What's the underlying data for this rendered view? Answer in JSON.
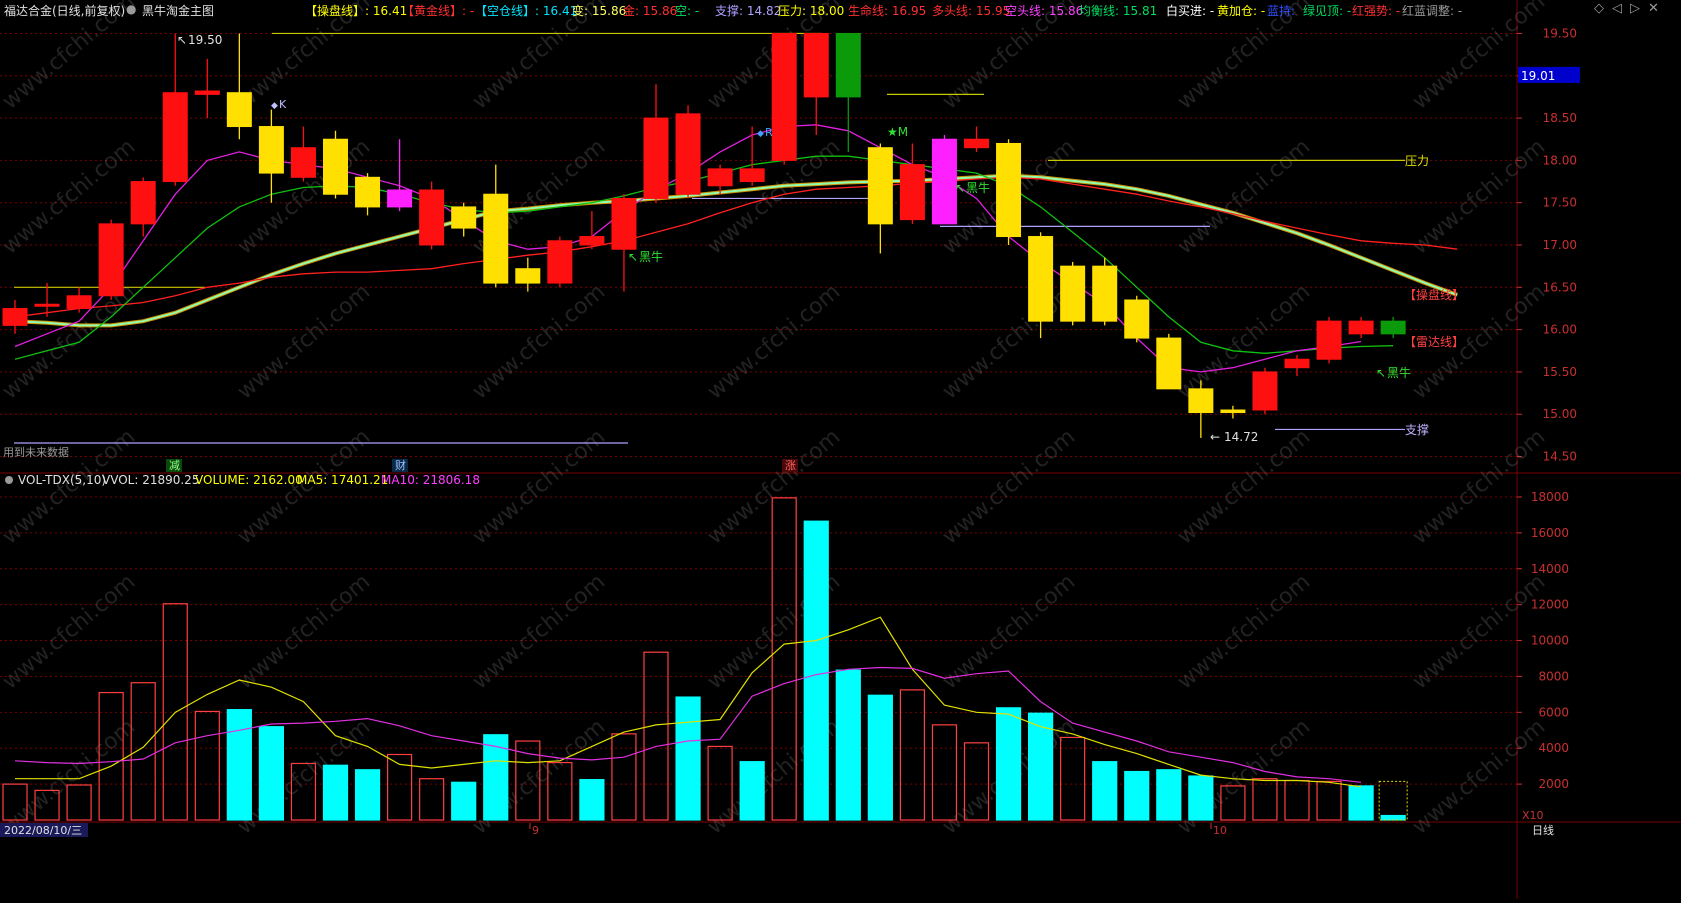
{
  "header": {
    "title": "福达合金(日线,前复权)",
    "indicator_name": "黑牛淘金主图",
    "items": [
      {
        "text": "【操盘线】: 16.41",
        "color": "#ffff00"
      },
      {
        "text": "【黄金线】: -",
        "color": "#ff3030"
      },
      {
        "text": "【空仓线】: 16.41",
        "color": "#00e5ff"
      },
      {
        "text": "变: 15.86",
        "color": "#ffff66"
      },
      {
        "text": "金: 15.86",
        "color": "#ff3030"
      },
      {
        "text": "空: -",
        "color": "#00e060"
      },
      {
        "text": "支撑: 14.82",
        "color": "#b0a0ff"
      },
      {
        "text": "压力: 18.00",
        "color": "#ffff00"
      },
      {
        "text": "生命线: 16.95",
        "color": "#ff3030"
      },
      {
        "text": "多头线: 15.95",
        "color": "#ff3030"
      },
      {
        "text": "空头线: 15.86",
        "color": "#ff40ff"
      },
      {
        "text": "均衡线: 15.81",
        "color": "#00e060"
      },
      {
        "text": "白买进: -",
        "color": "#ffffff"
      },
      {
        "text": "黄加仓: -",
        "color": "#ffff00"
      },
      {
        "text": "蓝持:",
        "color": "#3050ff"
      },
      {
        "text": "绿见顶: -",
        "color": "#00e060"
      },
      {
        "text": "红强势: -",
        "color": "#ff3030"
      },
      {
        "text": "红蓝调整: -",
        "color": "#9a9a9a"
      }
    ]
  },
  "price_axis": {
    "ticks": [
      "19.50",
      "19.00",
      "18.50",
      "18.00",
      "17.50",
      "17.00",
      "16.50",
      "16.00",
      "15.50",
      "15.00",
      "14.50"
    ],
    "current_price": "19.01"
  },
  "volume_header": {
    "name": "VOL-TDX(5,10)",
    "vvol": "VVOL: 21890.25",
    "volume": "VOLUME: 2162.00",
    "ma5": "MA5: 17401.21",
    "ma10": "MA10: 21806.18"
  },
  "volume_axis": {
    "ticks": [
      "18000",
      "16000",
      "14000",
      "12000",
      "10000",
      "8000",
      "6000",
      "4000",
      "2000"
    ],
    "unit": "X10"
  },
  "labels": {
    "future_data": "用到未来数据",
    "event_1": "减",
    "event_2": "财",
    "event_3": "涨",
    "high_mark": "19.50",
    "low_mark": "14.72",
    "mark_k": "K",
    "mark_r": "R",
    "mark_m": "★M",
    "black_bull": "黑牛",
    "pressure": "压力",
    "support": "支撑",
    "operate_line": "【操盘线】",
    "radar_line": "【雷达线】"
  },
  "time_axis": {
    "start_date": "2022/08/10/三",
    "month_9": "9",
    "month_10": "10",
    "period": "日线"
  },
  "watermark": "www.cfchi.com",
  "colors": {
    "background": "#000000",
    "grid": "#7a0000",
    "axis_text": "#c83030",
    "up": "#ff1010",
    "yellow": "#ffe000",
    "cyan": "#00ffff",
    "green": "#0a9a0a",
    "magenta": "#ff20ff"
  },
  "chart_data": [
    {
      "type": "candlestick",
      "title": "福达合金(日线,前复权)",
      "ylim": [
        14.4,
        19.6
      ],
      "candles": [
        {
          "o": 16.05,
          "c": 16.25,
          "h": 16.35,
          "l": 15.95,
          "color": "red"
        },
        {
          "o": 16.28,
          "c": 16.3,
          "h": 16.55,
          "l": 16.15,
          "color": "red"
        },
        {
          "o": 16.25,
          "c": 16.4,
          "h": 16.5,
          "l": 16.2,
          "color": "red"
        },
        {
          "o": 16.4,
          "c": 17.25,
          "h": 17.3,
          "l": 16.35,
          "color": "red"
        },
        {
          "o": 17.25,
          "c": 17.75,
          "h": 17.8,
          "l": 17.1,
          "color": "red"
        },
        {
          "o": 17.75,
          "c": 18.8,
          "h": 19.5,
          "l": 17.7,
          "color": "red"
        },
        {
          "o": 18.78,
          "c": 18.82,
          "h": 19.2,
          "l": 18.5,
          "color": "red"
        },
        {
          "o": 18.8,
          "c": 18.4,
          "h": 19.5,
          "l": 18.25,
          "color": "yellow"
        },
        {
          "o": 18.4,
          "c": 17.85,
          "h": 18.6,
          "l": 17.5,
          "color": "yellow"
        },
        {
          "o": 17.8,
          "c": 18.15,
          "h": 18.4,
          "l": 17.75,
          "color": "red"
        },
        {
          "o": 18.25,
          "c": 17.6,
          "h": 18.35,
          "l": 17.55,
          "color": "yellow"
        },
        {
          "o": 17.8,
          "c": 17.45,
          "h": 17.85,
          "l": 17.35,
          "color": "yellow"
        },
        {
          "o": 17.45,
          "c": 17.65,
          "h": 18.25,
          "l": 17.4,
          "color": "magenta"
        },
        {
          "o": 17.65,
          "c": 17.0,
          "h": 17.75,
          "l": 16.95,
          "color": "red"
        },
        {
          "o": 17.45,
          "c": 17.2,
          "h": 17.5,
          "l": 17.1,
          "color": "yellow"
        },
        {
          "o": 17.6,
          "c": 16.55,
          "h": 17.95,
          "l": 16.5,
          "color": "yellow"
        },
        {
          "o": 16.55,
          "c": 16.72,
          "h": 16.85,
          "l": 16.45,
          "color": "yellow"
        },
        {
          "o": 16.55,
          "c": 17.05,
          "h": 17.1,
          "l": 16.5,
          "color": "red"
        },
        {
          "o": 17.0,
          "c": 17.1,
          "h": 17.4,
          "l": 16.95,
          "color": "red"
        },
        {
          "o": 16.95,
          "c": 17.55,
          "h": 17.6,
          "l": 16.45,
          "color": "red"
        },
        {
          "o": 17.55,
          "c": 18.5,
          "h": 18.9,
          "l": 17.5,
          "color": "red"
        },
        {
          "o": 17.6,
          "c": 18.55,
          "h": 18.65,
          "l": 17.55,
          "color": "red"
        },
        {
          "o": 17.7,
          "c": 17.9,
          "h": 17.95,
          "l": 17.6,
          "color": "red"
        },
        {
          "o": 17.75,
          "c": 17.9,
          "h": 18.4,
          "l": 17.7,
          "color": "red"
        },
        {
          "o": 18.0,
          "c": 19.5,
          "h": 19.5,
          "l": 17.95,
          "color": "red"
        },
        {
          "o": 18.75,
          "c": 19.5,
          "h": 19.5,
          "l": 18.3,
          "color": "red"
        },
        {
          "o": 18.75,
          "c": 19.5,
          "h": 19.5,
          "l": 18.1,
          "color": "green"
        },
        {
          "o": 18.15,
          "c": 17.25,
          "h": 18.2,
          "l": 16.9,
          "color": "yellow"
        },
        {
          "o": 17.3,
          "c": 17.95,
          "h": 18.2,
          "l": 17.25,
          "color": "red"
        },
        {
          "o": 18.25,
          "c": 17.25,
          "h": 18.3,
          "l": 17.25,
          "color": "magenta"
        },
        {
          "o": 18.15,
          "c": 18.25,
          "h": 18.4,
          "l": 18.1,
          "color": "red"
        },
        {
          "o": 18.2,
          "c": 17.1,
          "h": 18.25,
          "l": 17.0,
          "color": "yellow"
        },
        {
          "o": 17.1,
          "c": 16.1,
          "h": 17.15,
          "l": 15.9,
          "color": "yellow"
        },
        {
          "o": 16.75,
          "c": 16.1,
          "h": 16.8,
          "l": 16.05,
          "color": "yellow"
        },
        {
          "o": 16.75,
          "c": 16.1,
          "h": 16.85,
          "l": 16.05,
          "color": "yellow"
        },
        {
          "o": 16.35,
          "c": 15.9,
          "h": 16.4,
          "l": 15.85,
          "color": "yellow"
        },
        {
          "o": 15.9,
          "c": 15.3,
          "h": 15.95,
          "l": 15.3,
          "color": "yellow"
        },
        {
          "o": 15.3,
          "c": 15.02,
          "h": 15.4,
          "l": 14.72,
          "color": "yellow"
        },
        {
          "o": 15.05,
          "c": 15.02,
          "h": 15.1,
          "l": 14.95,
          "color": "yellow"
        },
        {
          "o": 15.05,
          "c": 15.5,
          "h": 15.55,
          "l": 15.0,
          "color": "red"
        },
        {
          "o": 15.55,
          "c": 15.65,
          "h": 15.7,
          "l": 15.45,
          "color": "red"
        },
        {
          "o": 15.65,
          "c": 16.1,
          "h": 16.15,
          "l": 15.6,
          "color": "red"
        },
        {
          "o": 15.95,
          "c": 16.1,
          "h": 16.15,
          "l": 15.9,
          "color": "red"
        },
        {
          "o": 16.1,
          "c": 15.95,
          "h": 16.15,
          "l": 15.9,
          "color": "green"
        }
      ],
      "lines": [
        {
          "name": "操盘线",
          "values": [
            16.1,
            16.08,
            16.05,
            16.05,
            16.1,
            16.2,
            16.35,
            16.5,
            16.65,
            16.78,
            16.9,
            17.0,
            17.1,
            17.2,
            17.3,
            17.4,
            17.43,
            17.47,
            17.5,
            17.52,
            17.55,
            17.58,
            17.62,
            17.66,
            17.7,
            17.72,
            17.74,
            17.75,
            17.76,
            17.78,
            17.8,
            17.82,
            17.8,
            17.76,
            17.72,
            17.66,
            17.58,
            17.48,
            17.38,
            17.26,
            17.14,
            17.0,
            16.85,
            16.7,
            16.55,
            16.41
          ]
        },
        {
          "name": "生命线",
          "values": [
            16.15,
            16.2,
            16.25,
            16.28,
            16.32,
            16.4,
            16.5,
            16.55,
            16.62,
            16.66,
            16.68,
            16.68,
            16.7,
            16.72,
            16.78,
            16.83,
            16.88,
            16.92,
            16.98,
            17.05,
            17.15,
            17.25,
            17.38,
            17.5,
            17.6,
            17.66,
            17.68,
            17.7,
            17.73,
            17.75,
            17.78,
            17.8,
            17.78,
            17.72,
            17.66,
            17.6,
            17.52,
            17.45,
            17.37,
            17.28,
            17.2,
            17.12,
            17.05,
            17.02,
            17.0,
            16.95
          ]
        },
        {
          "name": "均衡线",
          "values": [
            15.65,
            15.75,
            15.85,
            16.15,
            16.5,
            16.85,
            17.2,
            17.45,
            17.6,
            17.68,
            17.7,
            17.68,
            17.6,
            17.5,
            17.42,
            17.38,
            17.4,
            17.45,
            17.5,
            17.58,
            17.68,
            17.75,
            17.85,
            17.95,
            18.0,
            18.05,
            18.05,
            18.0,
            17.95,
            17.9,
            17.85,
            17.7,
            17.45,
            17.15,
            16.85,
            16.5,
            16.15,
            15.85,
            15.75,
            15.72,
            15.75,
            15.78,
            15.8,
            15.81
          ]
        },
        {
          "name": "空头线",
          "values": [
            15.8,
            15.95,
            16.1,
            16.5,
            17.05,
            17.6,
            18.0,
            18.1,
            18.0,
            17.95,
            17.9,
            17.8,
            17.7,
            17.55,
            17.3,
            17.05,
            16.95,
            16.98,
            17.1,
            17.4,
            17.65,
            17.85,
            18.1,
            18.3,
            18.4,
            18.42,
            18.35,
            18.15,
            17.95,
            17.8,
            17.55,
            17.1,
            16.8,
            16.55,
            16.3,
            15.9,
            15.55,
            15.5,
            15.55,
            15.65,
            15.75,
            15.8,
            15.86
          ]
        }
      ]
    },
    {
      "type": "bar",
      "title": "VOL-TDX(5,10)",
      "ylim": [
        0,
        18500
      ],
      "volumes": [
        2000,
        1650,
        1950,
        7100,
        7650,
        12050,
        6050,
        6150,
        5200,
        3150,
        3050,
        2800,
        3650,
        2300,
        2100,
        4750,
        4400,
        3200,
        2250,
        4800,
        9350,
        6850,
        4100,
        3250,
        17950,
        16650,
        8350,
        6950,
        7250,
        5300,
        4300,
        6250,
        5950,
        4600,
        3250,
        2700,
        2800,
        2450,
        1900,
        2300,
        2200,
        2150,
        1900,
        250
      ],
      "volume_colors": [
        "r",
        "r",
        "r",
        "r",
        "r",
        "r",
        "r",
        "c",
        "c",
        "r",
        "c",
        "c",
        "r",
        "r",
        "c",
        "c",
        "r",
        "r",
        "c",
        "r",
        "r",
        "c",
        "r",
        "c",
        "r",
        "c",
        "c",
        "c",
        "r",
        "r",
        "r",
        "c",
        "c",
        "r",
        "c",
        "c",
        "c",
        "c",
        "r",
        "r",
        "r",
        "r",
        "c",
        "c"
      ],
      "ma5": [
        2300,
        2300,
        2300,
        3000,
        4050,
        6000,
        7000,
        7800,
        7400,
        6600,
        4700,
        4100,
        3100,
        2900,
        3100,
        3300,
        3200,
        3300,
        4100,
        4900,
        5300,
        5450,
        5600,
        8200,
        9800,
        10000,
        10600,
        11300,
        8400,
        6400,
        6000,
        5900,
        5200,
        4800,
        4200,
        3700,
        3100,
        2500,
        2300,
        2200,
        2200,
        2100,
        1850
      ],
      "ma10": [
        3300,
        3200,
        3150,
        3250,
        3400,
        4300,
        4700,
        5000,
        5350,
        5400,
        5500,
        5650,
        5250,
        4700,
        4400,
        4100,
        3700,
        3450,
        3350,
        3500,
        4100,
        4400,
        4500,
        6900,
        7600,
        8100,
        8400,
        8500,
        8450,
        7900,
        8150,
        8300,
        6600,
        5400,
        4900,
        4400,
        3800,
        3500,
        3200,
        2700,
        2400,
        2300,
        2100
      ]
    }
  ]
}
